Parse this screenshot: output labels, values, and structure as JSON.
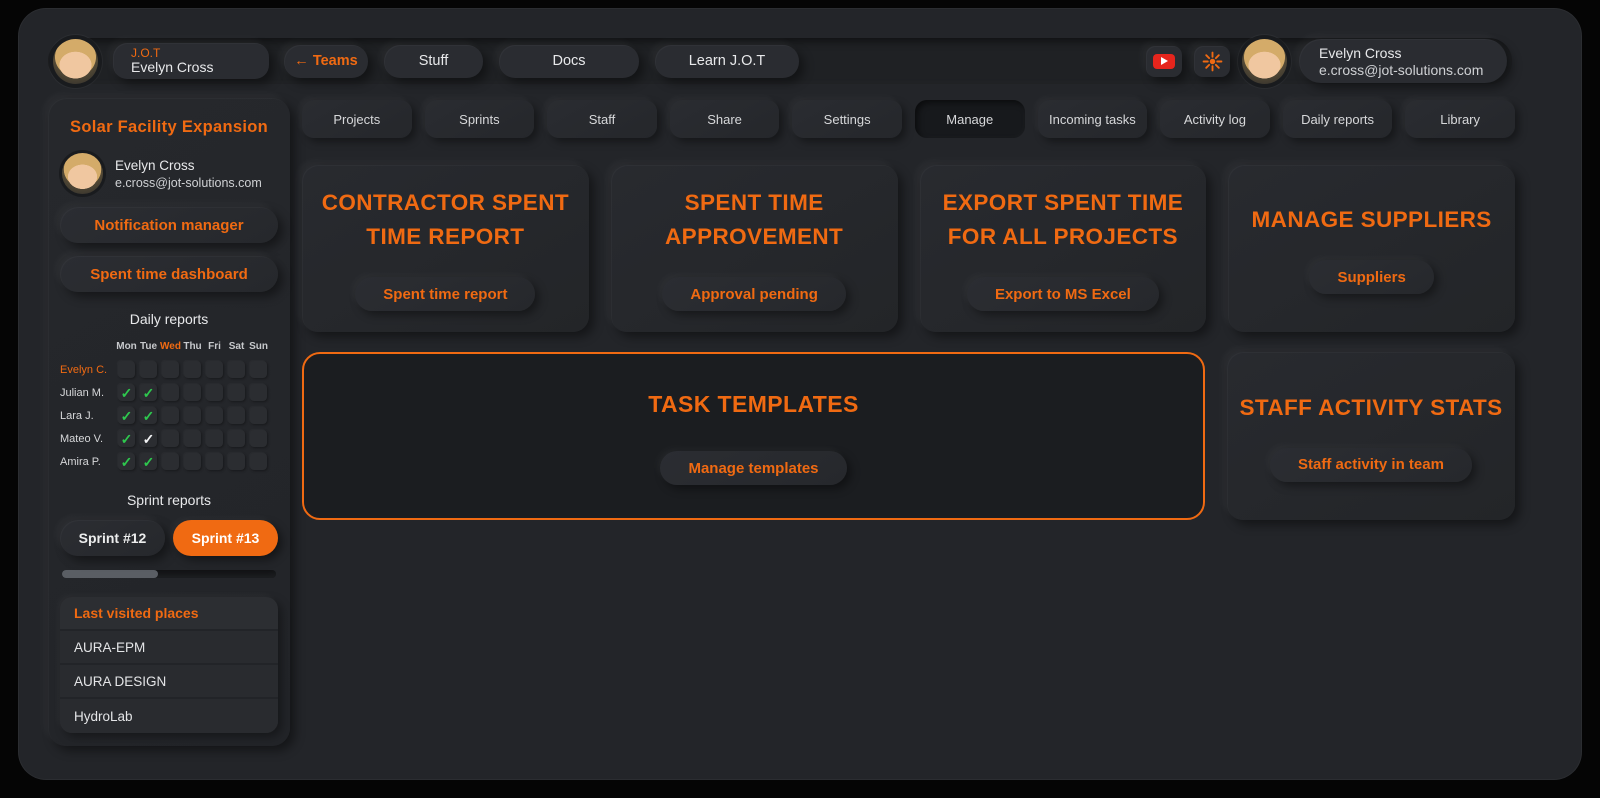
{
  "colors": {
    "accent": "#f06a12",
    "green_check": "#2ec84e",
    "youtube_red": "#e6251d"
  },
  "topbar": {
    "workspace": {
      "app": "J.O.T",
      "user": "Evelyn Cross"
    },
    "nav": [
      {
        "label": "← Teams",
        "accent": true
      },
      {
        "label": "Stuff",
        "accent": false
      },
      {
        "label": "Docs",
        "accent": false
      },
      {
        "label": "Learn J.O.T",
        "accent": false
      }
    ],
    "icons": [
      "youtube-icon",
      "sun-icon"
    ],
    "profile": {
      "name": "Evelyn Cross",
      "email": "e.cross@jot-solutions.com"
    }
  },
  "sidebar": {
    "project_title": "Solar Facility Expansion",
    "user": {
      "name": "Evelyn Cross",
      "email": "e.cross@jot-solutions.com"
    },
    "buttons": [
      "Notification manager",
      "Spent time dashboard"
    ],
    "daily_reports": {
      "title": "Daily reports",
      "days": [
        "Mon",
        "Tue",
        "Wed",
        "Thu",
        "Fri",
        "Sat",
        "Sun"
      ],
      "current_day": "Wed",
      "rows": [
        {
          "name": "Evelyn C.",
          "current": true,
          "checks": [
            "",
            "",
            "",
            "",
            "",
            "",
            ""
          ]
        },
        {
          "name": "Julian M.",
          "current": false,
          "checks": [
            "green",
            "green",
            "",
            "",
            "",
            "",
            ""
          ]
        },
        {
          "name": "Lara J.",
          "current": false,
          "checks": [
            "green",
            "green",
            "",
            "",
            "",
            "",
            ""
          ]
        },
        {
          "name": "Mateo V.",
          "current": false,
          "checks": [
            "green",
            "white",
            "",
            "",
            "",
            "",
            ""
          ]
        },
        {
          "name": "Amira P.",
          "current": false,
          "checks": [
            "green",
            "green",
            "",
            "",
            "",
            "",
            ""
          ]
        }
      ]
    },
    "sprint_reports": {
      "title": "Sprint reports",
      "sprints": [
        {
          "label": "Sprint #12",
          "active": false
        },
        {
          "label": "Sprint #13",
          "active": true
        }
      ],
      "scroll_thumb_pct": 45
    },
    "last_visited": {
      "title": "Last visited places",
      "items": [
        "AURA-EPM",
        "AURA DESIGN",
        "HydroLab"
      ]
    }
  },
  "main": {
    "tabs": [
      {
        "label": "Projects",
        "active": false
      },
      {
        "label": "Sprints",
        "active": false
      },
      {
        "label": "Staff",
        "active": false
      },
      {
        "label": "Share",
        "active": false
      },
      {
        "label": "Settings",
        "active": false
      },
      {
        "label": "Manage",
        "active": true
      },
      {
        "label": "Incoming tasks",
        "active": false
      },
      {
        "label": "Activity log",
        "active": false
      },
      {
        "label": "Daily reports",
        "active": false
      },
      {
        "label": "Library",
        "active": false
      }
    ],
    "cards": [
      {
        "title": "CONTRACTOR SPENT TIME REPORT",
        "button": "Spent time report"
      },
      {
        "title": "SPENT TIME APPROVEMENT",
        "button": "Approval pending"
      },
      {
        "title": "EXPORT SPENT TIME FOR ALL PROJECTS",
        "button": "Export to MS Excel"
      },
      {
        "title": "MANAGE SUPPLIERS",
        "button": "Suppliers"
      }
    ],
    "task_templates": {
      "title": "TASK TEMPLATES",
      "button": "Manage templates"
    },
    "staff_stats": {
      "title": "STAFF ACTIVITY STATS",
      "button": "Staff activity in team"
    }
  }
}
